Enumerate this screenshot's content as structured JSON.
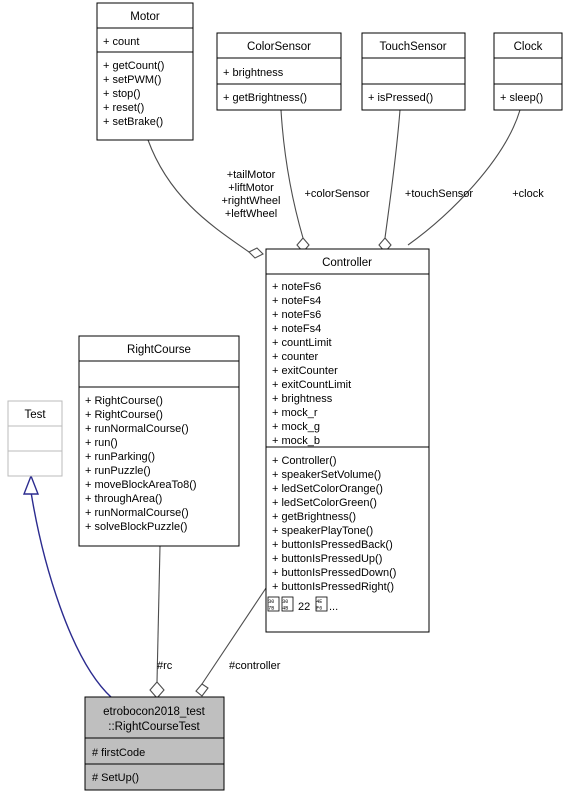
{
  "diagram": {
    "kind": "uml-class-diagram",
    "background": "#ffffff",
    "focus_fill": "#bfbfbf",
    "inheritance_color": "#2b2b8f",
    "link_color": "#4d4d4d"
  },
  "classes": {
    "motor": {
      "name": "Motor",
      "attributes": [
        "+ count"
      ],
      "operations": [
        "+ getCount()",
        "+ setPWM()",
        "+ stop()",
        "+ reset()",
        "+ setBrake()"
      ]
    },
    "color_sensor": {
      "name": "ColorSensor",
      "attributes": [
        "+ brightness"
      ],
      "operations": [
        "+ getBrightness()"
      ]
    },
    "touch_sensor": {
      "name": "TouchSensor",
      "attributes": [],
      "operations": [
        "+ isPressed()"
      ]
    },
    "clock": {
      "name": "Clock",
      "attributes": [],
      "operations": [
        "+ sleep()"
      ]
    },
    "controller": {
      "name": "Controller",
      "attributes": [
        "+ noteFs6",
        "+ noteFs4",
        "+ noteFs6",
        "+ noteFs4",
        "+ countLimit",
        "+ counter",
        "+ exitCounter",
        "+ exitCountLimit",
        "+ brightness",
        "+ mock_r",
        "+ mock_g",
        "+ mock_b"
      ],
      "operations": [
        "+ Controller()",
        "+ speakerSetVolume()",
        "+ ledSetColorOrange()",
        "+ ledSetColorGreen()",
        "+ getBrightness()",
        "+ speakerPlayTone()",
        "+ buttonIsPressedBack()",
        "+ buttonIsPressedUp()",
        "+ buttonIsPressedDown()",
        "+ buttonIsPressedRight()"
      ],
      "overflow_note": {
        "glyph_1_codepoint": "307B",
        "glyph_2_codepoint": "304B",
        "count": "22",
        "glyph_3_codepoint": "4EF6",
        "ellipsis": "...",
        "plain_text": "ほか 22 件..."
      }
    },
    "right_course": {
      "name": "RightCourse",
      "attributes": [],
      "operations": [
        "+ RightCourse()",
        "+ RightCourse()",
        "+ runNormalCourse()",
        "+ run()",
        "+ runParking()",
        "+ runPuzzle()",
        "+ moveBlockAreaTo8()",
        "+ throughArea()",
        "+ runNormalCourse()",
        "+ solveBlockPuzzle()"
      ]
    },
    "test": {
      "name": "Test",
      "attributes": [],
      "operations": []
    },
    "right_course_test": {
      "name_line_1": "etrobocon2018_test",
      "name_line_2": "::RightCourseTest",
      "attributes": [
        "# firstCode"
      ],
      "operations": [
        "# SetUp()"
      ]
    }
  },
  "edges": {
    "motor_to_controller": {
      "label_lines": [
        "+tailMotor",
        "+liftMotor",
        "+rightWheel",
        "+leftWheel"
      ],
      "type": "aggregation"
    },
    "color_sensor_to_controller": {
      "label": "+colorSensor",
      "type": "aggregation"
    },
    "touch_sensor_to_controller": {
      "label": "+touchSensor",
      "type": "aggregation"
    },
    "clock_to_controller": {
      "label": "+clock",
      "type": "aggregation"
    },
    "right_course_to_test_class": {
      "label": "#rc",
      "type": "aggregation"
    },
    "controller_to_test_class": {
      "label": "#controller",
      "type": "aggregation"
    },
    "test_inheritance": {
      "label": "",
      "type": "generalization"
    }
  }
}
